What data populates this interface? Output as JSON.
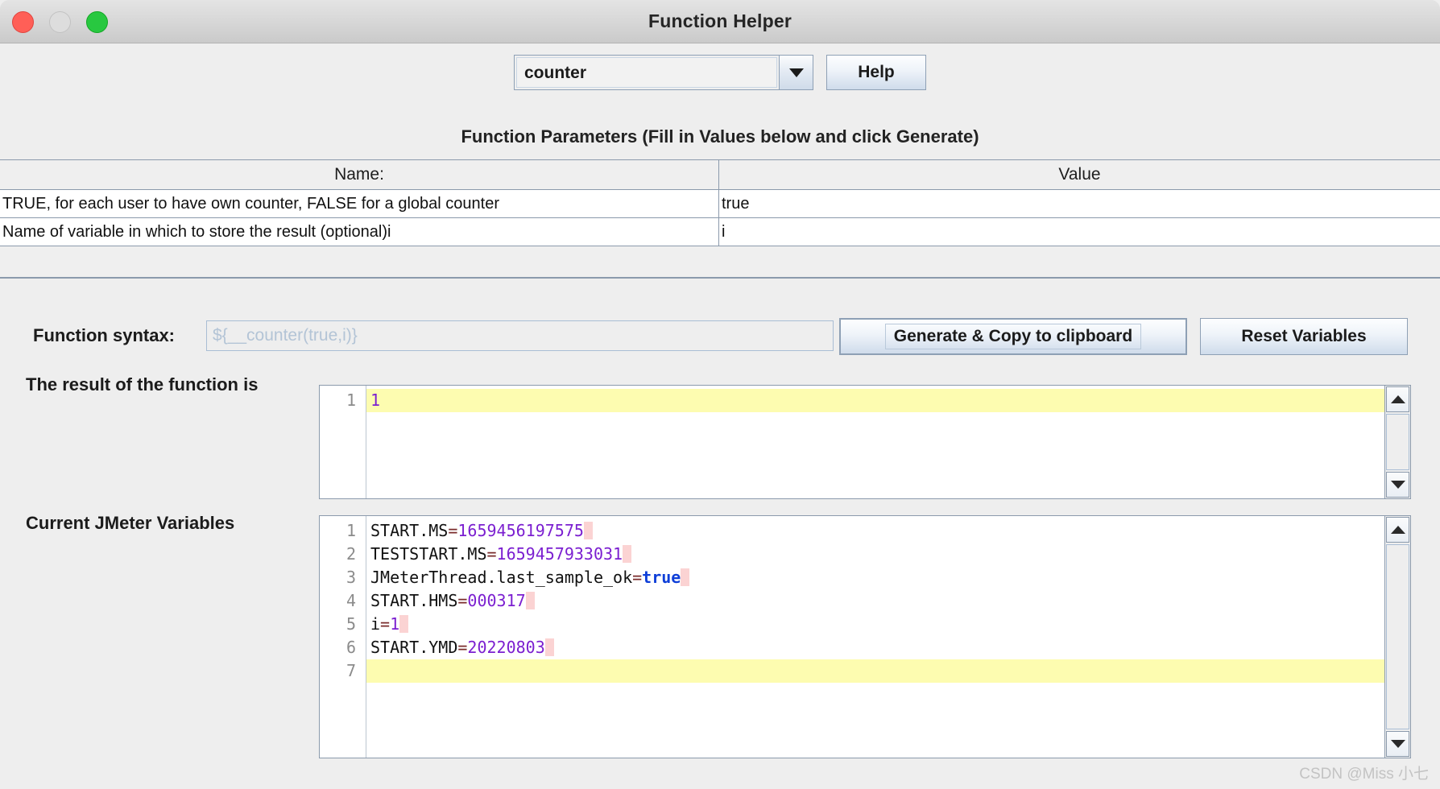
{
  "window": {
    "title": "Function Helper",
    "controls": {
      "close": "close-button",
      "minimize": "minimize-button",
      "zoom": "zoom-button"
    }
  },
  "toolbar": {
    "function_selected": "counter",
    "dropdown_icon": "chevron-down-icon",
    "help_label": "Help"
  },
  "parameters": {
    "header": "Function Parameters (Fill in Values below and click Generate)",
    "columns": [
      "Name:",
      "Value"
    ],
    "rows": [
      {
        "name": "TRUE, for each user to have own counter, FALSE for a global counter",
        "value": "true"
      },
      {
        "name": "Name of variable in which to store the result (optional)i",
        "value": "i"
      }
    ]
  },
  "syntax": {
    "label": "Function syntax:",
    "value": "${__counter(true,i)}",
    "generate_label": "Generate & Copy to clipboard",
    "reset_label": "Reset Variables"
  },
  "result": {
    "label": "The result of the function is",
    "lines": [
      {
        "no": "1",
        "text": "1",
        "highlight": true
      }
    ],
    "scroll": {
      "up_icon": "scroll-up-arrow-icon",
      "down_icon": "scroll-down-arrow-icon"
    }
  },
  "variables": {
    "label": "Current JMeter Variables",
    "lines": [
      {
        "no": "1",
        "key": "START.MS",
        "value": "1659456197575",
        "type": "num",
        "highlight": false
      },
      {
        "no": "2",
        "key": "TESTSTART.MS",
        "value": "1659457933031",
        "type": "num",
        "highlight": false
      },
      {
        "no": "3",
        "key": "JMeterThread.last_sample_ok",
        "value": "true",
        "type": "bool",
        "highlight": false
      },
      {
        "no": "4",
        "key": "START.HMS",
        "value": "000317",
        "type": "num",
        "highlight": false
      },
      {
        "no": "5",
        "key": "i",
        "value": "1",
        "type": "num",
        "highlight": false
      },
      {
        "no": "6",
        "key": "START.YMD",
        "value": "20220803",
        "type": "num",
        "highlight": false
      },
      {
        "no": "7",
        "key": "",
        "value": "",
        "type": "",
        "highlight": true
      }
    ],
    "scroll": {
      "up_icon": "scroll-up-arrow-icon",
      "down_icon": "scroll-down-arrow-icon"
    }
  },
  "watermark": "CSDN @Miss 小七",
  "colors": {
    "highlight_line": "#fdfcb0",
    "number_token": "#7b1fd0",
    "boolean_token": "#0f3fd8",
    "equals_token": "#7a2b2b",
    "eol_marker": "#fbd3d3",
    "window_bg": "#eeeeee",
    "border": "#8b9aac"
  }
}
